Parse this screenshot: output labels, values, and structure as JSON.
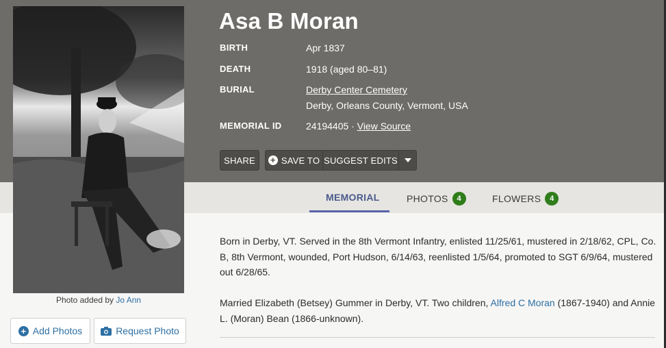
{
  "memorial": {
    "name": "Asa B Moran",
    "birth_label": "BIRTH",
    "birth_value": "Apr 1837",
    "death_label": "DEATH",
    "death_value": "1918 (aged 80–81)",
    "burial_label": "BURIAL",
    "burial_cemetery": "Derby Center Cemetery",
    "burial_location": "Derby, Orleans County, Vermont, USA",
    "memorial_id_label": "MEMORIAL ID",
    "memorial_id_value": "24194405 ·",
    "view_source": "View Source"
  },
  "actions": {
    "share": "SHARE",
    "save_to": "SAVE TO",
    "suggest_edits": "SUGGEST EDITS",
    "more_icon": "caret-down-icon"
  },
  "photo": {
    "credit_prefix": "Photo added by",
    "credit_user": "Jo Ann",
    "add_photos": "Add Photos",
    "request_photo": "Request Photo"
  },
  "tabs": [
    {
      "label": "MEMORIAL"
    },
    {
      "label": "PHOTOS",
      "count": "4"
    },
    {
      "label": "FLOWERS",
      "count": "4"
    }
  ],
  "bio": {
    "paragraph1": "Born in Derby, VT. Served in the 8th Vermont Infantry, enlisted 11/25/61, mustered in 2/18/62, CPL, Co. B, 8th Vermont, wounded, Port Hudson, 6/14/63, reenlisted 1/5/64, promoted to SGT 6/9/64, mustered out 6/28/65.",
    "paragraph2_a": "Married Elizabeth (Betsey) Gummer in Derby, VT. Two children,",
    "paragraph2_link": "Alfred C Moran",
    "paragraph2_b": "(1867-1940) and Annie L. (Moran) Bean (1866-unknown)."
  },
  "colors": {
    "hero_bg": "#6e6c68",
    "link": "#2d6fa3",
    "active_tab": "#5a63a8",
    "badge": "#2e7d1a"
  }
}
